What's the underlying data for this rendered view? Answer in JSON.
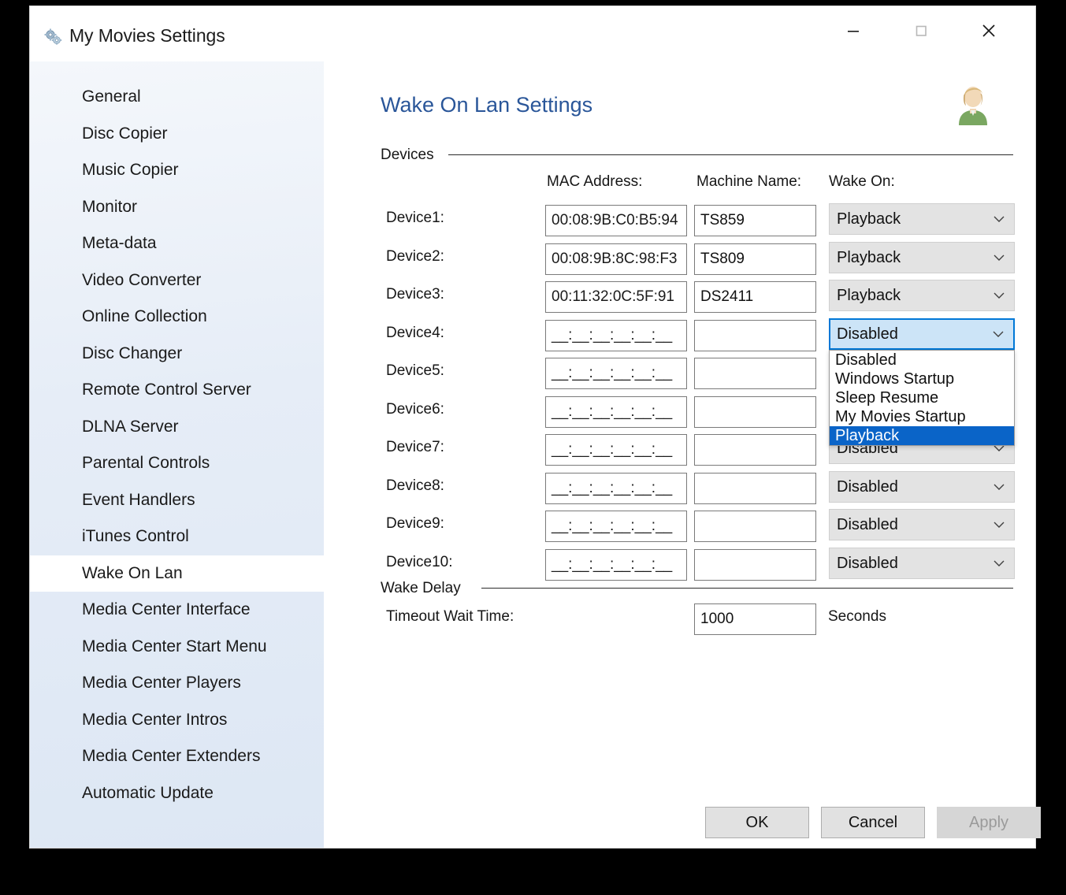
{
  "window": {
    "title": "My Movies Settings",
    "icon": "gears-icon",
    "controls": {
      "minimize": "minimize-icon",
      "maximize": "maximize-icon",
      "close": "close-icon"
    }
  },
  "sidebar": {
    "items": [
      {
        "label": "General",
        "selected": false
      },
      {
        "label": "Disc Copier",
        "selected": false
      },
      {
        "label": "Music Copier",
        "selected": false
      },
      {
        "label": "Monitor",
        "selected": false
      },
      {
        "label": "Meta-data",
        "selected": false
      },
      {
        "label": "Video Converter",
        "selected": false
      },
      {
        "label": "Online Collection",
        "selected": false
      },
      {
        "label": "Disc Changer",
        "selected": false
      },
      {
        "label": "Remote Control Server",
        "selected": false
      },
      {
        "label": "DLNA Server",
        "selected": false
      },
      {
        "label": "Parental Controls",
        "selected": false
      },
      {
        "label": "Event Handlers",
        "selected": false
      },
      {
        "label": "iTunes Control",
        "selected": false
      },
      {
        "label": "Wake On Lan",
        "selected": true
      },
      {
        "label": "Media Center Interface",
        "selected": false
      },
      {
        "label": "Media Center Start Menu",
        "selected": false
      },
      {
        "label": "Media Center Players",
        "selected": false
      },
      {
        "label": "Media Center Intros",
        "selected": false
      },
      {
        "label": "Media Center Extenders",
        "selected": false
      },
      {
        "label": "Automatic Update",
        "selected": false
      }
    ]
  },
  "main": {
    "page_title": "Wake On Lan Settings",
    "avatar": "user-avatar-icon",
    "devices_group": {
      "legend": "Devices",
      "columns": {
        "mac": "MAC Address:",
        "machine": "Machine Name:",
        "wake_on": "Wake On:"
      },
      "mac_mask": "__:__:__:__:__:__",
      "rows": [
        {
          "label": "Device1:",
          "mac": "00:08:9B:C0:B5:94",
          "machine": "TS859",
          "wake_on": "Playback"
        },
        {
          "label": "Device2:",
          "mac": "00:08:9B:8C:98:F3",
          "machine": "TS809",
          "wake_on": "Playback"
        },
        {
          "label": "Device3:",
          "mac": "00:11:32:0C:5F:91",
          "machine": "DS2411",
          "wake_on": "Playback"
        },
        {
          "label": "Device4:",
          "mac": "__:__:__:__:__:__",
          "machine": "",
          "wake_on": "Disabled"
        },
        {
          "label": "Device5:",
          "mac": "__:__:__:__:__:__",
          "machine": "",
          "wake_on": "Disabled"
        },
        {
          "label": "Device6:",
          "mac": "__:__:__:__:__:__",
          "machine": "",
          "wake_on": "Disabled"
        },
        {
          "label": "Device7:",
          "mac": "__:__:__:__:__:__",
          "machine": "",
          "wake_on": "Disabled"
        },
        {
          "label": "Device8:",
          "mac": "__:__:__:__:__:__",
          "machine": "",
          "wake_on": "Disabled"
        },
        {
          "label": "Device9:",
          "mac": "__:__:__:__:__:__",
          "machine": "",
          "wake_on": "Disabled"
        },
        {
          "label": "Device10:",
          "mac": "__:__:__:__:__:__",
          "machine": "",
          "wake_on": "Disabled"
        }
      ]
    },
    "dropdown": {
      "open_for_row": 4,
      "selected_value": "Disabled",
      "highlighted": "Playback",
      "options": [
        "Disabled",
        "Windows Startup",
        "Sleep Resume",
        "My Movies Startup",
        "Playback"
      ]
    },
    "wake_delay_group": {
      "legend": "Wake Delay",
      "timeout_label": "Timeout Wait Time:",
      "timeout_value": "1000",
      "unit": "Seconds"
    }
  },
  "footer": {
    "ok": "OK",
    "cancel": "Cancel",
    "apply": "Apply",
    "apply_disabled": true
  },
  "colors": {
    "accent_title": "#2a5699",
    "highlight_blue": "#0a64c8",
    "focus_blue": "#0078d7",
    "sidebar_bg": "#e6edf7"
  }
}
